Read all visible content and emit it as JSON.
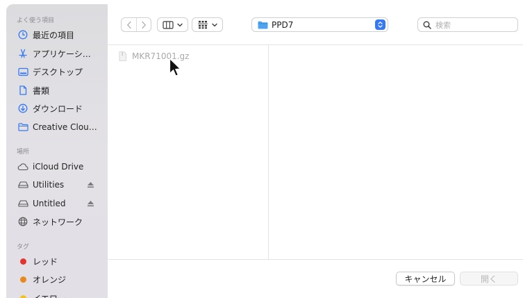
{
  "sidebar": {
    "favorites_header": "よく使う項目",
    "favorites": [
      {
        "label": "最近の項目",
        "icon": "clock-icon"
      },
      {
        "label": "アプリケーシ…",
        "icon": "applications-icon"
      },
      {
        "label": "デスクトップ",
        "icon": "desktop-icon"
      },
      {
        "label": "書類",
        "icon": "document-icon"
      },
      {
        "label": "ダウンロード",
        "icon": "download-icon"
      },
      {
        "label": "Creative Clou…",
        "icon": "folder-icon"
      }
    ],
    "locations_header": "場所",
    "locations": [
      {
        "label": "iCloud Drive",
        "icon": "cloud-icon"
      },
      {
        "label": "Utilities",
        "icon": "drive-icon",
        "eject": true
      },
      {
        "label": "Untitled",
        "icon": "drive-icon",
        "eject": true
      },
      {
        "label": "ネットワーク",
        "icon": "network-icon"
      }
    ],
    "tags_header": "タグ",
    "tags": [
      {
        "label": "レッド",
        "color": "#e5322d"
      },
      {
        "label": "オレンジ",
        "color": "#e8891d"
      },
      {
        "label": "イエロー",
        "color": "#f2c21b"
      }
    ]
  },
  "toolbar": {
    "path_folder": "PPD7",
    "search_placeholder": "検索"
  },
  "files": [
    {
      "name": "MKR71001.gz",
      "icon": "archive-file-icon"
    }
  ],
  "buttons": {
    "cancel": "キャンセル",
    "open": "開く"
  },
  "colors": {
    "accent": "#3478f6",
    "folder": "#4ea4ee"
  }
}
